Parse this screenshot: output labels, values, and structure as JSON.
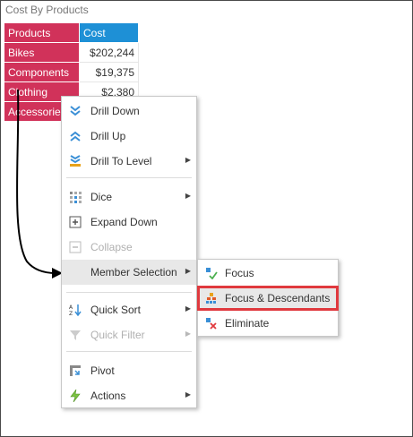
{
  "panel": {
    "title": "Cost By Products"
  },
  "grid": {
    "row_header_label": "Products",
    "column_header_label": "Cost",
    "rows": [
      {
        "product": "Bikes",
        "cost": "$202,244"
      },
      {
        "product": "Components",
        "cost": "$19,375"
      },
      {
        "product": "Clothing",
        "cost": "$2,380"
      },
      {
        "product": "Accessories",
        "cost": ""
      }
    ]
  },
  "context_menu": {
    "items": [
      {
        "label": "Drill Down",
        "icon": "drill-down-icon"
      },
      {
        "label": "Drill Up",
        "icon": "drill-up-icon"
      },
      {
        "label": "Drill To Level",
        "icon": "drill-to-level-icon",
        "submenu": true
      },
      {
        "label": "Dice",
        "icon": "dice-icon",
        "submenu": true
      },
      {
        "label": "Expand Down",
        "icon": "expand-down-icon"
      },
      {
        "label": "Collapse",
        "icon": "collapse-icon",
        "disabled": true
      },
      {
        "label": "Member Selection",
        "icon": "",
        "submenu": true,
        "highlighted": true
      },
      {
        "label": "Quick Sort",
        "icon": "quick-sort-icon",
        "submenu": true
      },
      {
        "label": "Quick Filter",
        "icon": "quick-filter-icon",
        "submenu": true,
        "disabled": true
      },
      {
        "label": "Pivot",
        "icon": "pivot-icon"
      },
      {
        "label": "Actions",
        "icon": "actions-icon",
        "submenu": true
      }
    ]
  },
  "submenu": {
    "items": [
      {
        "label": "Focus",
        "icon": "focus-icon"
      },
      {
        "label": "Focus & Descendants",
        "icon": "focus-descendants-icon",
        "outlined": true
      },
      {
        "label": "Eliminate",
        "icon": "eliminate-icon"
      }
    ]
  },
  "colors": {
    "row_header": "#d1325a",
    "column_header": "#1e90d6",
    "callout_outline": "#e0393e",
    "arrow": "#000000"
  }
}
